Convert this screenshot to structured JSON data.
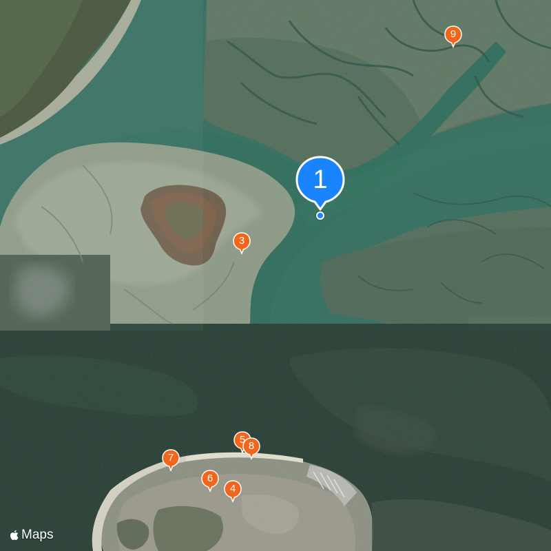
{
  "map": {
    "attribution": "Maps",
    "attribution_icon": "apple-logo-icon",
    "colors": {
      "primary_pin": "#1a84ff",
      "secondary_pin": "#f2661c",
      "water_deep": "#1e6b5a",
      "mudflat": "#8c9a83"
    },
    "markers": [
      {
        "id": "1",
        "label": "1",
        "kind": "primary",
        "selected": true
      },
      {
        "id": "3",
        "label": "3",
        "kind": "secondary"
      },
      {
        "id": "4",
        "label": "4",
        "kind": "secondary"
      },
      {
        "id": "5",
        "label": "5",
        "kind": "secondary"
      },
      {
        "id": "6",
        "label": "6",
        "kind": "secondary"
      },
      {
        "id": "7",
        "label": "7",
        "kind": "secondary"
      },
      {
        "id": "8",
        "label": "8",
        "kind": "secondary"
      },
      {
        "id": "9",
        "label": "9",
        "kind": "secondary"
      }
    ]
  }
}
